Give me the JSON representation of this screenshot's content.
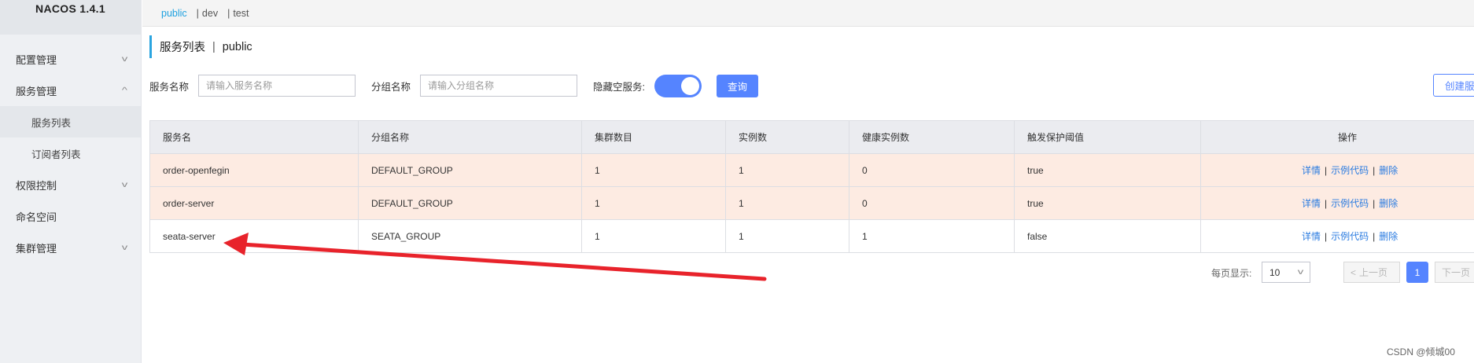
{
  "app": {
    "logo": "NACOS 1.4.1"
  },
  "sidebar": {
    "items": [
      {
        "label": "配置管理",
        "chevron": "v"
      },
      {
        "label": "服务管理",
        "chevron": "^"
      },
      {
        "label": "服务列表",
        "sub": true,
        "active": true
      },
      {
        "label": "订阅者列表",
        "sub": true
      },
      {
        "label": "权限控制",
        "chevron": "v"
      },
      {
        "label": "命名空间"
      },
      {
        "label": "集群管理",
        "chevron": "v"
      }
    ]
  },
  "namespaces": {
    "items": [
      "public",
      "dev",
      "test"
    ],
    "separator": "|",
    "active": "public"
  },
  "title": {
    "main": "服务列表",
    "separator": "|",
    "namespace": "public"
  },
  "filters": {
    "service_label": "服务名称",
    "service_placeholder": "请输入服务名称",
    "group_label": "分组名称",
    "group_placeholder": "请输入分组名称",
    "hide_empty_label": "隐藏空服务:",
    "hide_empty_on": true,
    "query_button": "查询",
    "create_button": "创建服务"
  },
  "table": {
    "columns": [
      "服务名",
      "分组名称",
      "集群数目",
      "实例数",
      "健康实例数",
      "触发保护阈值",
      "操作"
    ],
    "rows": [
      {
        "name": "order-openfegin",
        "group": "DEFAULT_GROUP",
        "clusters": "1",
        "instances": "1",
        "healthy": "0",
        "threshold": "true",
        "warn": true
      },
      {
        "name": "order-server",
        "group": "DEFAULT_GROUP",
        "clusters": "1",
        "instances": "1",
        "healthy": "0",
        "threshold": "true",
        "warn": true
      },
      {
        "name": "seata-server",
        "group": "SEATA_GROUP",
        "clusters": "1",
        "instances": "1",
        "healthy": "1",
        "threshold": "false",
        "warn": false
      }
    ],
    "actions": {
      "detail": "详情",
      "sample": "示例代码",
      "delete": "删除",
      "separator": "|"
    }
  },
  "pagination": {
    "per_page_label": "每页显示:",
    "per_page_value": "10",
    "prev": "上一页",
    "current": "1",
    "next": "下一页"
  },
  "watermark": "CSDN @倾城00",
  "colors": {
    "primary": "#5584ff",
    "accent": "#2ba5e0",
    "warn_row": "#fdebe2",
    "annotation_arrow": "#e8232b"
  }
}
